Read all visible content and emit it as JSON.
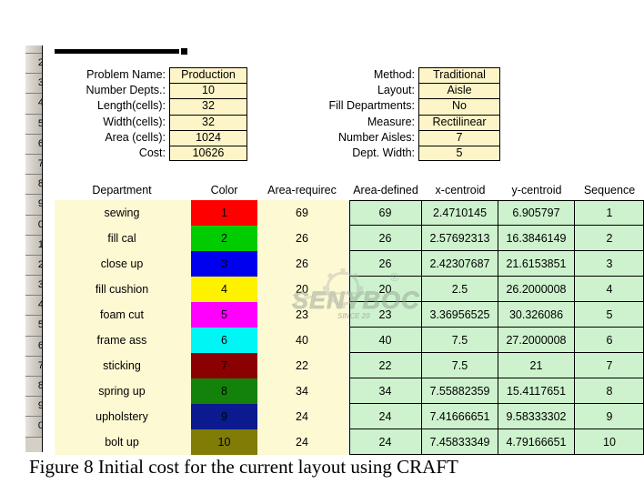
{
  "parameters_left": [
    {
      "label": "Problem Name:",
      "value": "Production"
    },
    {
      "label": "Number Depts.:",
      "value": "10"
    },
    {
      "label": "Length(cells):",
      "value": "32"
    },
    {
      "label": "Width(cells):",
      "value": "32"
    },
    {
      "label": "Area (cells):",
      "value": "1024"
    },
    {
      "label": "Cost:",
      "value": "10626"
    }
  ],
  "parameters_right": [
    {
      "label": "Method:",
      "value": "Traditional"
    },
    {
      "label": "Layout:",
      "value": "Aisle"
    },
    {
      "label": "Fill Departments:",
      "value": "No"
    },
    {
      "label": "Measure:",
      "value": "Rectilinear"
    },
    {
      "label": "Number Aisles:",
      "value": "7"
    },
    {
      "label": "Dept. Width:",
      "value": "5"
    }
  ],
  "table": {
    "headers": [
      "Department",
      "Color",
      "Area-requirec",
      "Area-defined",
      "x-centroid",
      "y-centroid",
      "Sequence"
    ],
    "rows": [
      {
        "department": "sewing",
        "color_index": "1",
        "color_hex": "#FF0000",
        "area_required": "69",
        "area_defined": "69",
        "x_centroid": "2.4710145",
        "y_centroid": "6.905797",
        "sequence": "1"
      },
      {
        "department": "fill cal",
        "color_index": "2",
        "color_hex": "#00CC00",
        "area_required": "26",
        "area_defined": "26",
        "x_centroid": "2.57692313",
        "y_centroid": "16.3846149",
        "sequence": "2"
      },
      {
        "department": "close up",
        "color_index": "3",
        "color_hex": "#0000EE",
        "area_required": "26",
        "area_defined": "26",
        "x_centroid": "2.42307687",
        "y_centroid": "21.6153851",
        "sequence": "3"
      },
      {
        "department": "fill cushion",
        "color_index": "4",
        "color_hex": "#FFF200",
        "area_required": "20",
        "area_defined": "20",
        "x_centroid": "2.5",
        "y_centroid": "26.2000008",
        "sequence": "4"
      },
      {
        "department": "foam cut",
        "color_index": "5",
        "color_hex": "#FF00FF",
        "area_required": "23",
        "area_defined": "23",
        "x_centroid": "3.36956525",
        "y_centroid": "30.326086",
        "sequence": "5"
      },
      {
        "department": "frame ass",
        "color_index": "6",
        "color_hex": "#00F5F5",
        "area_required": "40",
        "area_defined": "40",
        "x_centroid": "7.5",
        "y_centroid": "27.2000008",
        "sequence": "6"
      },
      {
        "department": "sticking",
        "color_index": "7",
        "color_hex": "#8B0000",
        "area_required": "22",
        "area_defined": "22",
        "x_centroid": "7.5",
        "y_centroid": "21",
        "sequence": "7"
      },
      {
        "department": "spring up",
        "color_index": "8",
        "color_hex": "#13820B",
        "area_required": "34",
        "area_defined": "34",
        "x_centroid": "7.55882359",
        "y_centroid": "15.4117651",
        "sequence": "8"
      },
      {
        "department": "upholstery",
        "color_index": "9",
        "color_hex": "#0B1A8E",
        "area_required": "24",
        "area_defined": "24",
        "x_centroid": "7.41666651",
        "y_centroid": "9.58333302",
        "sequence": "9"
      },
      {
        "department": "bolt up",
        "color_index": "10",
        "color_hex": "#807C06",
        "area_required": "24",
        "area_defined": "24",
        "x_centroid": "7.45833349",
        "y_centroid": "4.79166651",
        "sequence": "10"
      }
    ]
  },
  "row_headers": [
    "2",
    "3",
    "4",
    "5",
    "6",
    "7",
    "8",
    "9",
    "0",
    "1",
    "2",
    "3",
    "4",
    "5",
    "6",
    "7",
    "8",
    "9",
    "0"
  ],
  "watermark": {
    "text": "SENYBOC",
    "since": "SINCE 20",
    "registered": "®"
  },
  "caption": "Figure 8 Initial cost for the current layout using CRAFT",
  "colors": {
    "param_value_fill": "#fdf5c8",
    "table_left_fill": "#fdf9d3",
    "table_green_fill": "#cdf2cd",
    "gutter_fill": "#d4d0c8"
  }
}
